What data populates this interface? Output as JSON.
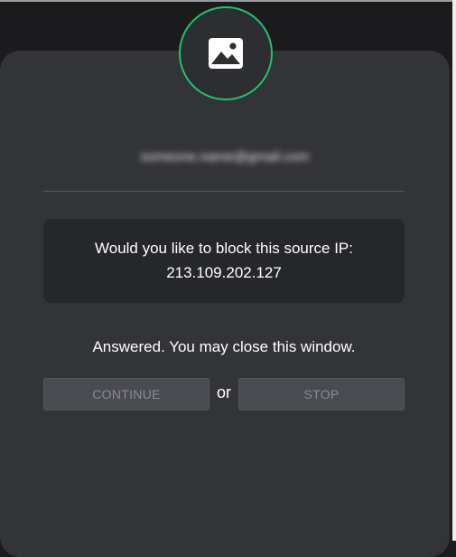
{
  "header": {
    "avatar_icon": "image-icon",
    "email": "someone.name@gmail.com"
  },
  "prompt": {
    "question": "Would you like to block this source IP:",
    "ip": "213.109.202.127"
  },
  "status_text": "Answered. You may close this window.",
  "actions": {
    "continue_label": "CONTINUE",
    "separator": "or",
    "stop_label": "STOP",
    "disabled": true
  },
  "colors": {
    "accent_ring": "#20c26c",
    "card_bg": "#333438",
    "box_bg": "#26272a"
  }
}
